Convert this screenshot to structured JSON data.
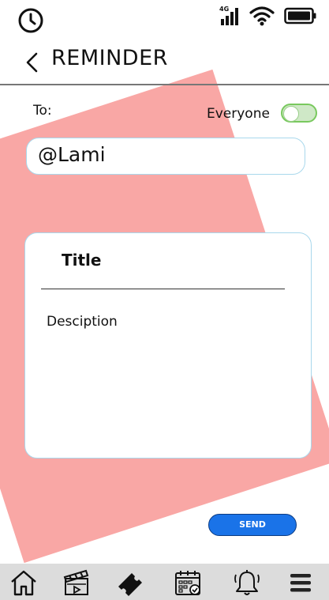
{
  "status_bar": {
    "network": "4G",
    "icons": [
      "clock-icon",
      "signal-4g-icon",
      "wifi-icon",
      "battery-icon"
    ]
  },
  "header": {
    "title": "REMINDER",
    "back_icon": "chevron-left-icon"
  },
  "form": {
    "to_label": "To:",
    "everyone_label": "Everyone",
    "everyone_toggle_on": false,
    "recipient_value": "@Lami"
  },
  "message": {
    "title_placeholder": "Title",
    "description_placeholder": "Desciption"
  },
  "actions": {
    "send_label": "SEND"
  },
  "bottom_nav": {
    "items": [
      "home-icon",
      "movie-clapper-icon",
      "ticket-icon",
      "calendar-icon",
      "bell-icon",
      "menu-icon"
    ]
  },
  "colors": {
    "accent_shape": "#f9a7a5",
    "send_button": "#1a73e8",
    "toggle_border": "#79c95e",
    "nav_background": "#dcdcdc",
    "input_border": "#a9d8ec"
  }
}
